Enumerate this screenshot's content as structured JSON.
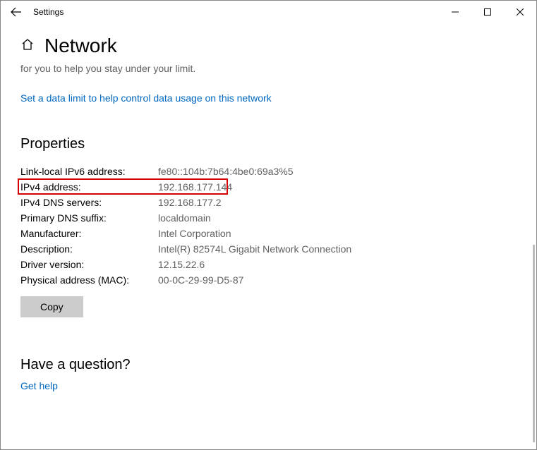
{
  "titlebar": {
    "title": "Settings"
  },
  "header": {
    "page_title": "Network"
  },
  "content": {
    "truncated_line": "for you to help you stay under your limit.",
    "data_limit_link": "Set a data limit to help control data usage on this network",
    "properties_heading": "Properties",
    "copy_label": "Copy",
    "question_heading": "Have a question?",
    "get_help_link": "Get help"
  },
  "properties": [
    {
      "label": "Link-local IPv6 address:",
      "value": "fe80::104b:7b64:4be0:69a3%5",
      "highlight": false
    },
    {
      "label": "IPv4 address:",
      "value": "192.168.177.144",
      "highlight": true
    },
    {
      "label": "IPv4 DNS servers:",
      "value": "192.168.177.2",
      "highlight": false
    },
    {
      "label": "Primary DNS suffix:",
      "value": "localdomain",
      "highlight": false
    },
    {
      "label": "Manufacturer:",
      "value": "Intel Corporation",
      "highlight": false
    },
    {
      "label": "Description:",
      "value": "Intel(R) 82574L Gigabit Network Connection",
      "highlight": false
    },
    {
      "label": "Driver version:",
      "value": "12.15.22.6",
      "highlight": false
    },
    {
      "label": "Physical address (MAC):",
      "value": "00-0C-29-99-D5-87",
      "highlight": false
    }
  ]
}
